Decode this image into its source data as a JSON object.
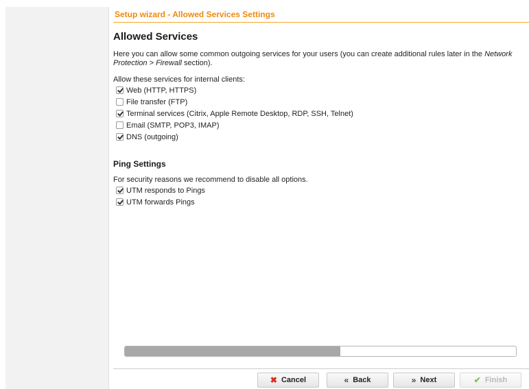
{
  "wizard": {
    "header": "Setup wizard - Allowed Services Settings"
  },
  "main": {
    "title": "Allowed Services",
    "description_pre": "Here you can allow some common outgoing services for your users (you can create additional rules later in the ",
    "description_link": "Network Protection > Firewall",
    "description_post": " section).",
    "services_label": "Allow these services for internal clients:",
    "services": [
      {
        "label": "Web (HTTP, HTTPS)",
        "checked": true
      },
      {
        "label": "File transfer (FTP)",
        "checked": false
      },
      {
        "label": "Terminal services (Citrix, Apple Remote Desktop, RDP, SSH, Telnet)",
        "checked": true
      },
      {
        "label": "Email (SMTP, POP3, IMAP)",
        "checked": false
      },
      {
        "label": "DNS (outgoing)",
        "checked": true
      }
    ]
  },
  "ping": {
    "title": "Ping Settings",
    "note": "For security reasons we recommend to disable all options.",
    "options": [
      {
        "label": "UTM responds to Pings",
        "checked": true
      },
      {
        "label": "UTM forwards Pings",
        "checked": true
      }
    ]
  },
  "progress": {
    "fraction": 0.55
  },
  "buttons": {
    "cancel": "Cancel",
    "back": "Back",
    "next": "Next",
    "finish": "Finish"
  },
  "icons": {
    "cancel": "close-icon",
    "back": "double-chevron-left-icon",
    "next": "double-chevron-right-icon",
    "finish": "checkmark-icon"
  },
  "colors": {
    "accent": "#f0890c",
    "cancel_icon": "#d92b1c",
    "finish_icon": "#7cc250",
    "progress_fill": "#a8a8a8"
  }
}
